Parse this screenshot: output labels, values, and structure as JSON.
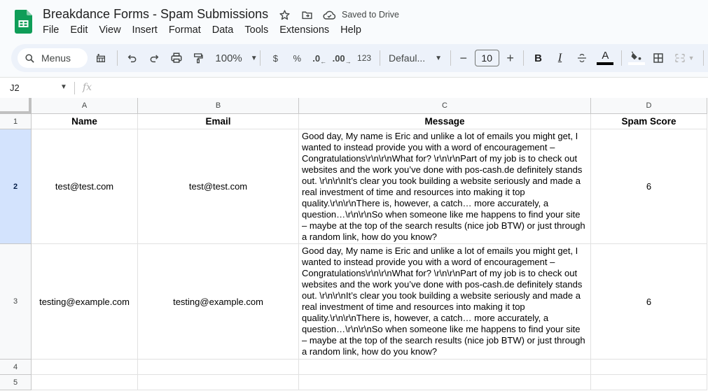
{
  "app": {
    "title": "Breakdance Forms - Spam Submissions",
    "saved_status": "Saved to Drive",
    "brand_color": "#0f9d58",
    "icons": [
      "star-icon",
      "move-to-folder-icon",
      "cloud-saved-icon"
    ]
  },
  "menu": [
    "File",
    "Edit",
    "View",
    "Insert",
    "Format",
    "Data",
    "Tools",
    "Extensions",
    "Help"
  ],
  "toolbar": {
    "search_label": "Menus",
    "zoom": "100%",
    "currency": "$",
    "percent": "%",
    "decrease_decimal": ".0",
    "increase_decimal": ".00",
    "number_format": "123",
    "font": "Defaul...",
    "font_size": "10",
    "minus": "−",
    "plus": "+",
    "bold": "B",
    "italic": "I",
    "text_color_label": "A",
    "text_color": "#000000",
    "fill_color": "#ffffff"
  },
  "formula_bar": {
    "cell_ref": "J2",
    "fx_label": "fx",
    "value": ""
  },
  "sheet": {
    "columns": [
      "A",
      "B",
      "C",
      "D"
    ],
    "row_numbers": [
      "1",
      "2",
      "3",
      "4",
      "5"
    ],
    "selected_row": "2",
    "headers": [
      "Name",
      "Email",
      "Message",
      "Spam Score"
    ],
    "rows": [
      {
        "name": "test@test.com",
        "email": "test@test.com",
        "message": "Good day, My name is Eric and unlike a lot of emails you might get, I wanted to instead provide you with a word of encouragement – Congratulations\\r\\n\\r\\nWhat for? \\r\\n\\r\\nPart of my job is to check out websites and the work you’ve done with pos-cash.de definitely stands out. \\r\\n\\r\\nIt’s clear you took building a website seriously and made a real investment of time and resources into making it top quality.\\r\\n\\r\\nThere is, however, a catch… more accurately, a question…\\r\\n\\r\\nSo when someone like me happens to find your site – maybe at the top of the search results (nice job BTW) or just through a random link, how do you know?",
        "spam_score": "6"
      },
      {
        "name": "testing@example.com",
        "email": "testing@example.com",
        "message": "Good day, My name is Eric and unlike a lot of emails you might get, I wanted to instead provide you with a word of encouragement – Congratulations\\r\\n\\r\\nWhat for? \\r\\n\\r\\nPart of my job is to check out websites and the work you’ve done with pos-cash.de definitely stands out. \\r\\n\\r\\nIt’s clear you took building a website seriously and made a real investment of time and resources into making it top quality.\\r\\n\\r\\nThere is, however, a catch… more accurately, a question…\\r\\n\\r\\nSo when someone like me happens to find your site – maybe at the top of the search results (nice job BTW) or just through a random link, how do you know?",
        "spam_score": "6"
      }
    ]
  }
}
